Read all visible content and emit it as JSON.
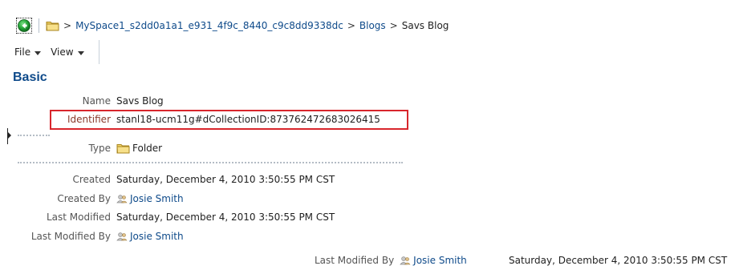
{
  "breadcrumb": {
    "items": [
      "MySpace1_s2dd0a1a1_e931_4f9c_8440_c9c8dd9338dc",
      "Blogs"
    ],
    "current": "Savs Blog",
    "separator": ">"
  },
  "menu": {
    "file": "File",
    "view": "View"
  },
  "section": {
    "title": "Basic"
  },
  "properties": {
    "name": {
      "label": "Name",
      "value": "Savs Blog"
    },
    "identifier": {
      "label": "Identifier",
      "value": "stanl18-ucm11g#dCollectionID:873762472683026415"
    },
    "type": {
      "label": "Type",
      "value": "Folder"
    },
    "created": {
      "label": "Created",
      "value": "Saturday, December 4, 2010 3:50:55 PM CST"
    },
    "created_by": {
      "label": "Created By",
      "value": "Josie Smith"
    },
    "last_modified": {
      "label": "Last Modified",
      "value": "Saturday, December 4, 2010 3:50:55 PM CST"
    },
    "last_modified_by": {
      "label": "Last Modified By",
      "value": "Josie Smith"
    }
  },
  "footer": {
    "label": "Last Modified By",
    "user": "Josie Smith",
    "date": "Saturday, December 4, 2010 3:50:55 PM CST"
  },
  "colors": {
    "link": "#0e4a8a",
    "highlight": "#d8262c",
    "back_button": "#1e9b33",
    "folder": "#f3d66b"
  },
  "icons": {
    "back": "back-arrow-icon",
    "folder": "folder-icon",
    "user": "user-icon",
    "menu_caret": "chevron-down-icon",
    "splitter": "triangle-right-icon"
  }
}
